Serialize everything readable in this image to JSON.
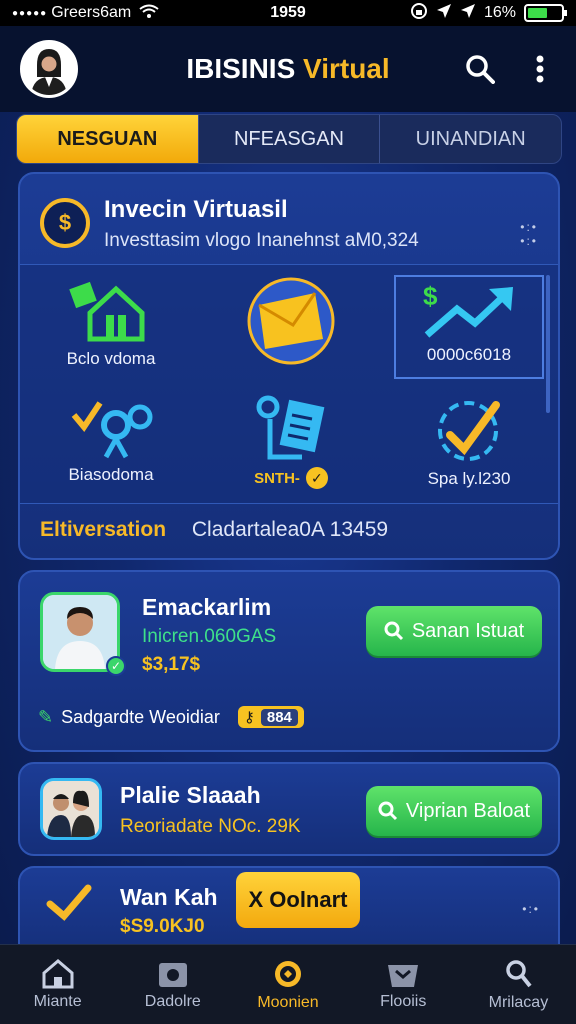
{
  "status_bar": {
    "carrier": "Greers6am",
    "time": "1959",
    "battery": "16%"
  },
  "header": {
    "title_part1": "IBISINIS",
    "title_part2": "Virtual",
    "avatar_icon": "user-avatar"
  },
  "tabs": [
    {
      "label": "NESGUAN",
      "active": true
    },
    {
      "label": "NFEASGAN",
      "active": false
    },
    {
      "label": "UINANDIAN",
      "active": false
    }
  ],
  "main_card": {
    "title": "Invecin Virtuasil",
    "subtitle": "Investtasim vlogo Inanehnst  aM0,324",
    "tiles": [
      {
        "label": "Bclo vdoma",
        "icon": "house-icon"
      },
      {
        "label": "",
        "icon": "envelope-icon"
      },
      {
        "label": "0000c6018",
        "icon": "trend-arrow-icon"
      },
      {
        "label": "Biasodoma",
        "icon": "location-pin-icon"
      },
      {
        "label": "SNTH-",
        "icon": "document-search-icon"
      },
      {
        "label": "Spa ly.l230",
        "icon": "checkmark-circle-icon"
      }
    ],
    "footer_highlight": "Eltiversation",
    "footer_value": "Cladartalea0A 13459"
  },
  "user_cards": [
    {
      "name": "Emackarlim",
      "line1": "Inicren.060GAS",
      "line2": "$3,17$",
      "button": "Sanan Istuat",
      "extra": "Sadgardte Weoidiar",
      "badge": "884"
    },
    {
      "name": "Plalie Slaaah",
      "line1": "Reoriadate NOc. 29K",
      "button": "Viprian Baloat"
    },
    {
      "name": "Wan Kah",
      "line1": "$S9.0KJ0",
      "button": "X Oolnart"
    }
  ],
  "bottom_nav": [
    {
      "label": "Miante",
      "icon": "home-icon",
      "active": false
    },
    {
      "label": "Dadolre",
      "icon": "wallet-icon",
      "active": false
    },
    {
      "label": "Moonien",
      "icon": "target-icon",
      "active": true
    },
    {
      "label": "Flooiis",
      "icon": "inbox-icon",
      "active": false
    },
    {
      "label": "Mrilacay",
      "icon": "person-search-icon",
      "active": false
    }
  ],
  "colors": {
    "accent": "#f7b928",
    "green": "#3bd66b",
    "background": "#10286e"
  }
}
